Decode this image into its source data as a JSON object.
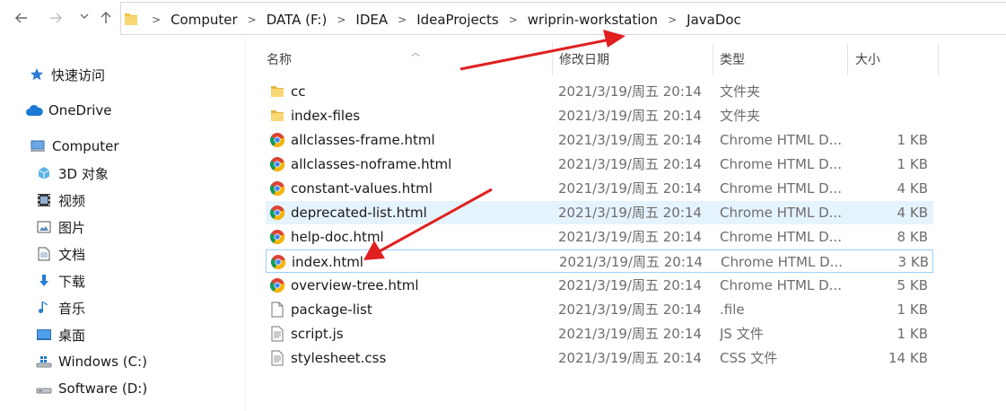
{
  "address_bar": {
    "crumbs": [
      "Computer",
      "DATA (F:)",
      "IDEA",
      "IdeaProjects",
      "wriprin-workstation",
      "JavaDoc"
    ]
  },
  "nav_pane": {
    "items": [
      {
        "label": "快速访问",
        "icon": "star-icon"
      },
      {
        "label": "OneDrive",
        "icon": "cloud-icon"
      },
      {
        "label": "Computer",
        "icon": "computer-icon"
      },
      {
        "label": "3D 对象",
        "icon": "cube-icon"
      },
      {
        "label": "视频",
        "icon": "video-icon"
      },
      {
        "label": "图片",
        "icon": "picture-icon"
      },
      {
        "label": "文档",
        "icon": "document-icon"
      },
      {
        "label": "下载",
        "icon": "download-icon"
      },
      {
        "label": "音乐",
        "icon": "music-icon"
      },
      {
        "label": "桌面",
        "icon": "desktop-icon"
      },
      {
        "label": "Windows (C:)",
        "icon": "drive-icon"
      },
      {
        "label": "Software (D:)",
        "icon": "drive-icon"
      }
    ]
  },
  "columns": {
    "name": "名称",
    "date": "修改日期",
    "type": "类型",
    "size": "大小"
  },
  "files": [
    {
      "name": "cc",
      "date": "2021/3/19/周五 20:14",
      "type": "文件夹",
      "size": "",
      "icon": "folder-icon"
    },
    {
      "name": "index-files",
      "date": "2021/3/19/周五 20:14",
      "type": "文件夹",
      "size": "",
      "icon": "folder-icon"
    },
    {
      "name": "allclasses-frame.html",
      "date": "2021/3/19/周五 20:14",
      "type": "Chrome HTML D...",
      "size": "1 KB",
      "icon": "chrome-icon"
    },
    {
      "name": "allclasses-noframe.html",
      "date": "2021/3/19/周五 20:14",
      "type": "Chrome HTML D...",
      "size": "1 KB",
      "icon": "chrome-icon"
    },
    {
      "name": "constant-values.html",
      "date": "2021/3/19/周五 20:14",
      "type": "Chrome HTML D...",
      "size": "4 KB",
      "icon": "chrome-icon"
    },
    {
      "name": "deprecated-list.html",
      "date": "2021/3/19/周五 20:14",
      "type": "Chrome HTML D...",
      "size": "4 KB",
      "icon": "chrome-icon"
    },
    {
      "name": "help-doc.html",
      "date": "2021/3/19/周五 20:14",
      "type": "Chrome HTML D...",
      "size": "8 KB",
      "icon": "chrome-icon"
    },
    {
      "name": "index.html",
      "date": "2021/3/19/周五 20:14",
      "type": "Chrome HTML D...",
      "size": "3 KB",
      "icon": "chrome-icon"
    },
    {
      "name": "overview-tree.html",
      "date": "2021/3/19/周五 20:14",
      "type": "Chrome HTML D...",
      "size": "5 KB",
      "icon": "chrome-icon"
    },
    {
      "name": "package-list",
      "date": "2021/3/19/周五 20:14",
      "type": ".file",
      "size": "1 KB",
      "icon": "file-icon"
    },
    {
      "name": "script.js",
      "date": "2021/3/19/周五 20:14",
      "type": "JS 文件",
      "size": "1 KB",
      "icon": "script-file-icon"
    },
    {
      "name": "stylesheet.css",
      "date": "2021/3/19/周五 20:14",
      "type": "CSS 文件",
      "size": "14 KB",
      "icon": "script-file-icon"
    }
  ],
  "colors": {
    "hover_row": "#e5f3ff",
    "selected_border": "#99d1ff",
    "annotation_arrow": "#e02020",
    "folder": "#f4c542"
  }
}
